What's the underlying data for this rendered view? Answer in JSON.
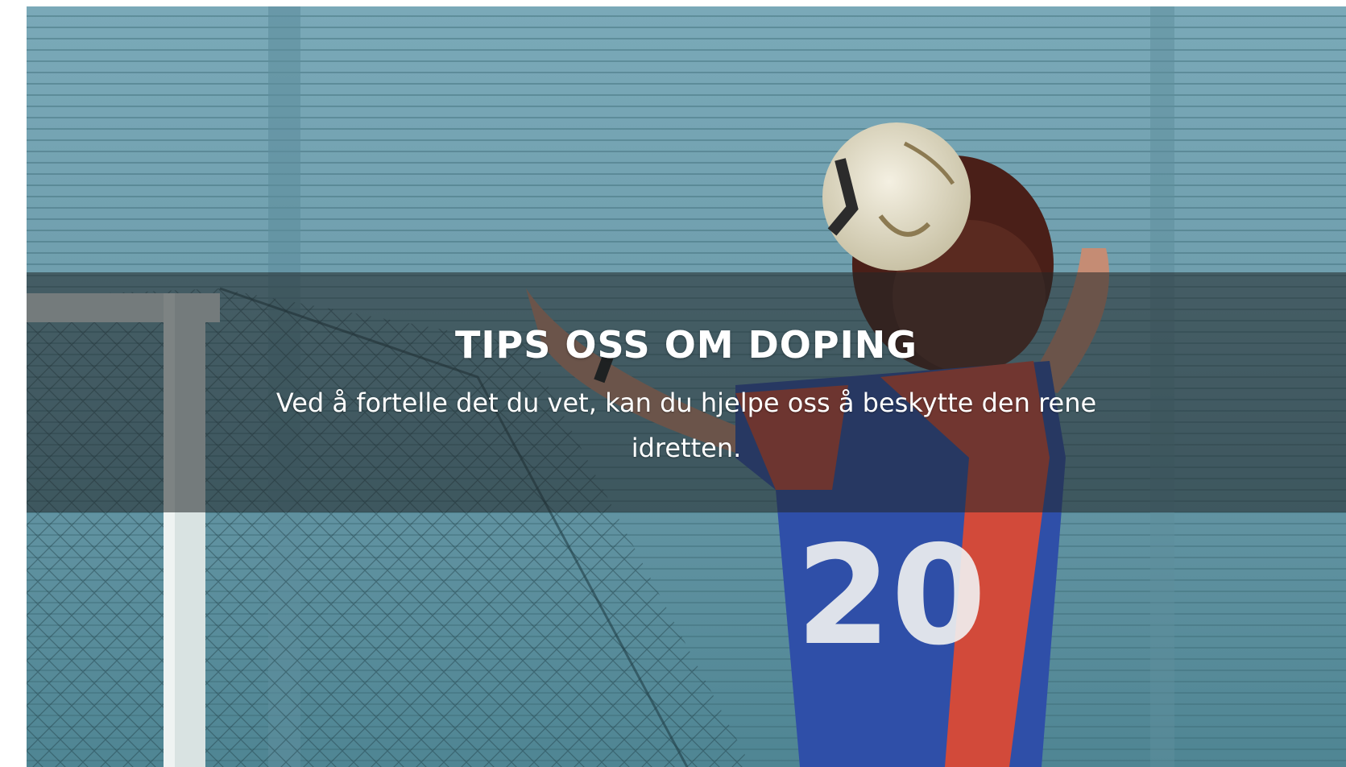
{
  "hero": {
    "background_image": "football-player-heading-ball-photo",
    "title": "TIPS OSS OM DOPING",
    "description": "Ved å fortelle det du vet, kan du hjelpe oss å beskytte den rene idretten."
  },
  "colors": {
    "overlay": "#20262899",
    "text": "#ffffff",
    "background": "#6f9fae",
    "jersey_blue": "#2f4fa8",
    "jersey_red": "#d24a3a"
  }
}
